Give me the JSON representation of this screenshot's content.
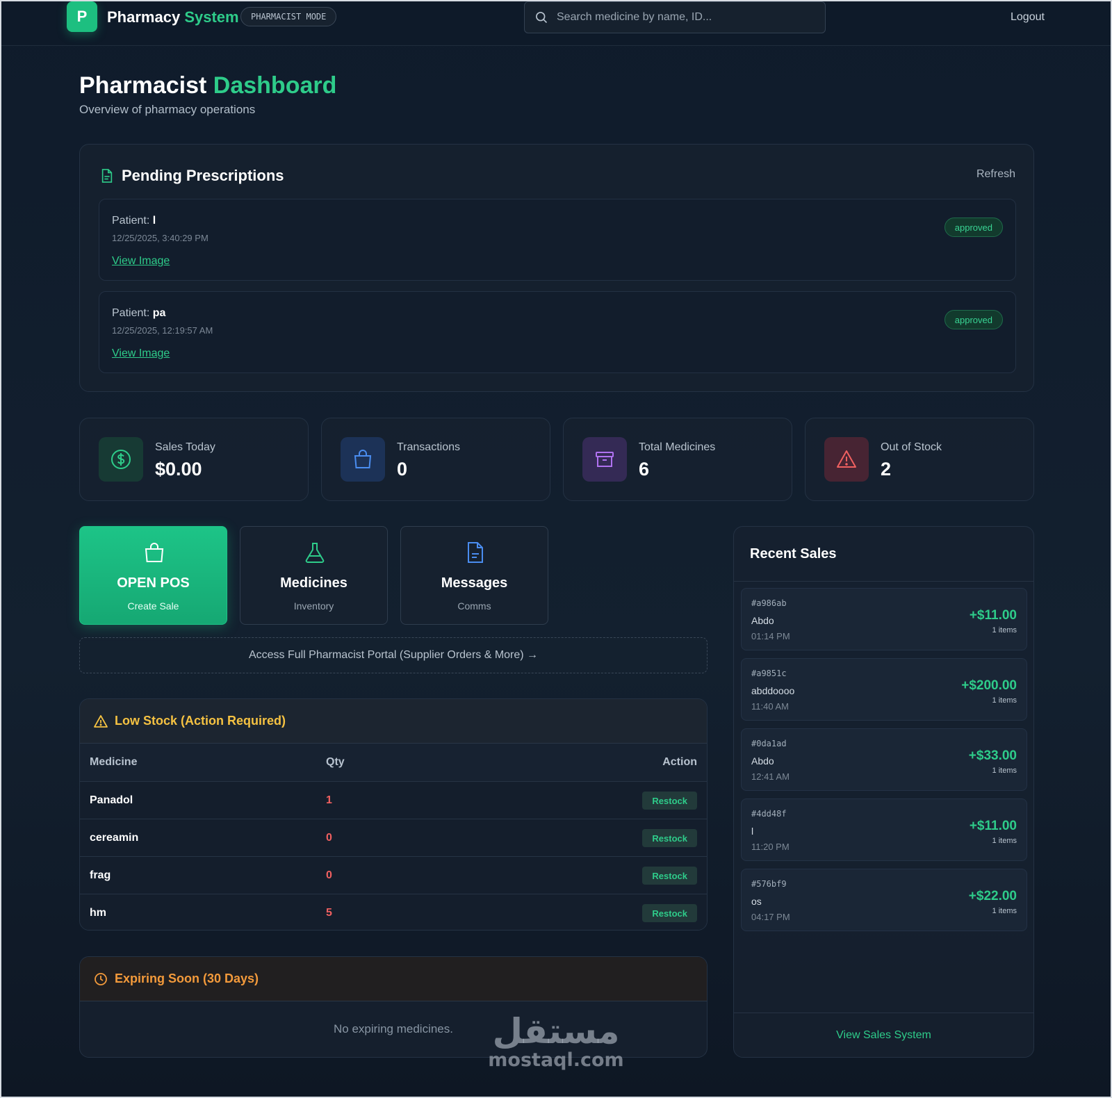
{
  "header": {
    "logo_letter": "P",
    "brand_part1": "Pharmacy",
    "brand_part2": "System",
    "mode_badge": "PHARMACIST MODE",
    "search_placeholder": "Search medicine by name, ID...",
    "logout_label": "Logout"
  },
  "page": {
    "title_part1": "Pharmacist",
    "title_part2": "Dashboard",
    "subtitle": "Overview of pharmacy operations"
  },
  "prescriptions": {
    "title": "Pending Prescriptions",
    "refresh_label": "Refresh",
    "patient_label": "Patient:",
    "view_label": "View Image",
    "items": [
      {
        "patient": "l",
        "date": "12/25/2025, 3:40:29 PM",
        "status": "approved"
      },
      {
        "patient": "pa",
        "date": "12/25/2025, 12:19:57 AM",
        "status": "approved"
      }
    ]
  },
  "stats": [
    {
      "label": "Sales Today",
      "value": "$0.00",
      "icon": "dollar-icon",
      "color": "#2ecc8a"
    },
    {
      "label": "Transactions",
      "value": "0",
      "icon": "shopping-bag-icon",
      "color": "#4a8df0"
    },
    {
      "label": "Total Medicines",
      "value": "6",
      "icon": "archive-box-icon",
      "color": "#b072f0"
    },
    {
      "label": "Out of Stock",
      "value": "2",
      "icon": "warning-triangle-icon",
      "color": "#f06060"
    }
  ],
  "tiles": [
    {
      "title": "OPEN POS",
      "subtitle": "Create Sale",
      "icon": "shopping-bag-icon"
    },
    {
      "title": "Medicines",
      "subtitle": "Inventory",
      "icon": "flask-icon"
    },
    {
      "title": "Messages",
      "subtitle": "Comms",
      "icon": "document-icon"
    }
  ],
  "portal_link": "Access Full Pharmacist Portal (Supplier Orders & More) →",
  "low_stock": {
    "title": "Low Stock (Action Required)",
    "columns": [
      "Medicine",
      "Qty",
      "Action"
    ],
    "restock_label": "Restock",
    "rows": [
      {
        "name": "Panadol",
        "qty": "1"
      },
      {
        "name": "cereamin",
        "qty": "0"
      },
      {
        "name": "frag",
        "qty": "0"
      },
      {
        "name": "hm",
        "qty": "5"
      }
    ]
  },
  "expiring": {
    "title": "Expiring Soon (30 Days)",
    "empty_text": "No expiring medicines."
  },
  "recent_sales": {
    "title": "Recent Sales",
    "footer_link": "View Sales System",
    "items": [
      {
        "id": "#a986ab",
        "customer": "Abdo",
        "time": "01:14 PM",
        "amount": "+$11.00",
        "items": "1 items"
      },
      {
        "id": "#a9851c",
        "customer": "abddoooo",
        "time": "11:40 AM",
        "amount": "+$200.00",
        "items": "1 items"
      },
      {
        "id": "#0da1ad",
        "customer": "Abdo",
        "time": "12:41 AM",
        "amount": "+$33.00",
        "items": "1 items"
      },
      {
        "id": "#4dd48f",
        "customer": "l",
        "time": "11:20 PM",
        "amount": "+$11.00",
        "items": "1 items"
      },
      {
        "id": "#576bf9",
        "customer": "os",
        "time": "04:17 PM",
        "amount": "+$22.00",
        "items": "1 items"
      }
    ]
  },
  "watermark": {
    "arabic": "مستقل",
    "latin": "mostaql.com"
  },
  "colors": {
    "accent": "#2ecc8a",
    "warning": "#f5c242",
    "orange": "#f39a3b",
    "danger": "#f06060",
    "background": "#0f1b2b"
  }
}
